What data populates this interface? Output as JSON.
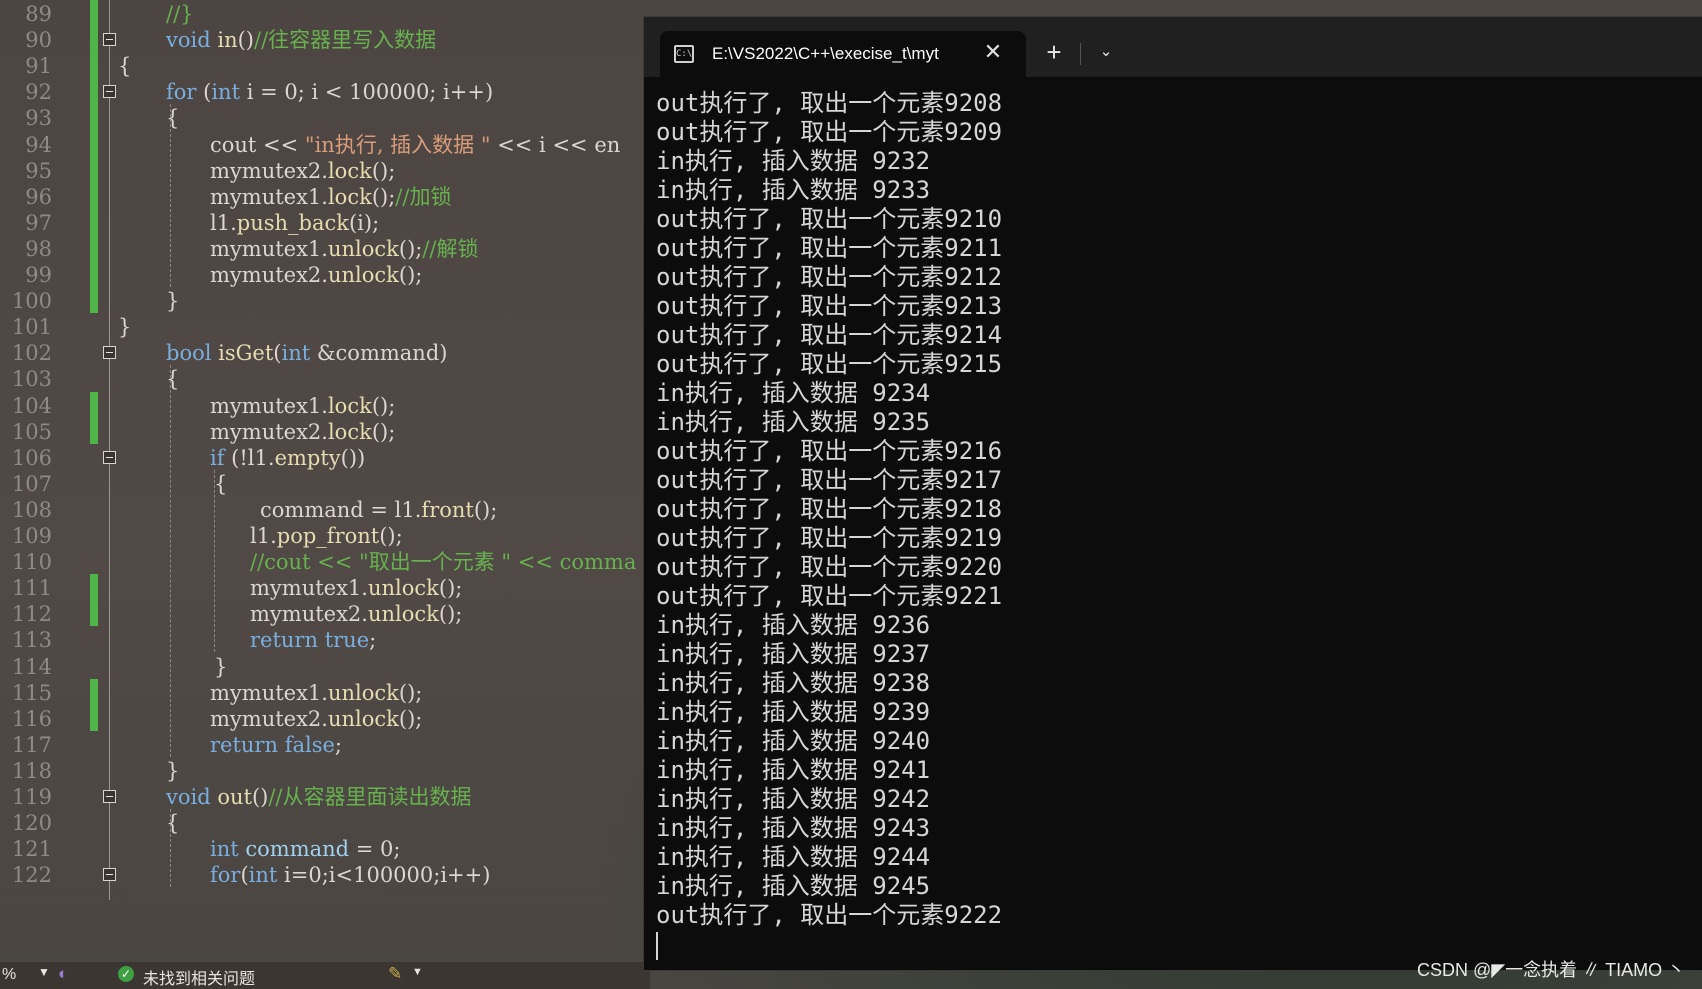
{
  "editor": {
    "line_numbers": [
      "89",
      "90",
      "91",
      "92",
      "93",
      "94",
      "95",
      "96",
      "97",
      "98",
      "99",
      "100",
      "101",
      "102",
      "103",
      "104",
      "105",
      "106",
      "107",
      "108",
      "109",
      "110",
      "111",
      "112",
      "113",
      "114",
      "115",
      "116",
      "117",
      "118",
      "119",
      "120",
      "121",
      "122"
    ],
    "lines": [
      {
        "t": [
          [
            "cm",
            "//}"
          ]
        ]
      },
      {
        "t": [
          [
            "kw",
            "void"
          ],
          [
            "p",
            " "
          ],
          [
            "fn",
            "in"
          ],
          [
            "p",
            "()"
          ],
          [
            "cm",
            "//往容器里写入数据"
          ]
        ]
      },
      {
        "t": [
          [
            "p",
            "{"
          ]
        ]
      },
      {
        "t": [
          [
            "kw",
            "for"
          ],
          [
            "p",
            " ("
          ],
          [
            "kw",
            "int"
          ],
          [
            "p",
            " i = 0; i < 100000; i++)"
          ]
        ]
      },
      {
        "t": [
          [
            "p",
            "{"
          ]
        ]
      },
      {
        "t": [
          [
            "p",
            "cout << "
          ],
          [
            "st",
            "\"in执行, 插入数据 \""
          ],
          [
            "p",
            " << i << en"
          ]
        ]
      },
      {
        "t": [
          [
            "p",
            "mymutex2."
          ],
          [
            "fn",
            "lock"
          ],
          [
            "p",
            "();"
          ]
        ]
      },
      {
        "t": [
          [
            "p",
            "mymutex1."
          ],
          [
            "fn",
            "lock"
          ],
          [
            "p",
            "();"
          ],
          [
            "cm",
            "//加锁"
          ]
        ]
      },
      {
        "t": [
          [
            "p",
            "l1."
          ],
          [
            "fn",
            "push_back"
          ],
          [
            "p",
            "(i);"
          ]
        ]
      },
      {
        "t": [
          [
            "p",
            "mymutex1."
          ],
          [
            "fn",
            "unlock"
          ],
          [
            "p",
            "();"
          ],
          [
            "cm",
            "//解锁"
          ]
        ]
      },
      {
        "t": [
          [
            "p",
            "mymutex2."
          ],
          [
            "fn",
            "unlock"
          ],
          [
            "p",
            "();"
          ]
        ]
      },
      {
        "t": [
          [
            "p",
            "}"
          ]
        ]
      },
      {
        "t": [
          [
            "p",
            "}"
          ]
        ]
      },
      {
        "t": [
          [
            "kw",
            "bool"
          ],
          [
            "p",
            " "
          ],
          [
            "fn",
            "isGet"
          ],
          [
            "p",
            "("
          ],
          [
            "kw",
            "int"
          ],
          [
            "p",
            " &command)"
          ]
        ]
      },
      {
        "t": [
          [
            "p",
            "{"
          ]
        ]
      },
      {
        "t": [
          [
            "p",
            "mymutex1."
          ],
          [
            "fn",
            "lock"
          ],
          [
            "p",
            "();"
          ]
        ]
      },
      {
        "t": [
          [
            "p",
            "mymutex2."
          ],
          [
            "fn",
            "lock"
          ],
          [
            "p",
            "();"
          ]
        ]
      },
      {
        "t": [
          [
            "kw",
            "if"
          ],
          [
            "p",
            " (!l1."
          ],
          [
            "fn",
            "empty"
          ],
          [
            "p",
            "())"
          ]
        ]
      },
      {
        "t": [
          [
            "p",
            "{"
          ]
        ]
      },
      {
        "t": [
          [
            "p",
            "command = l1."
          ],
          [
            "fn",
            "front"
          ],
          [
            "p",
            "();"
          ]
        ]
      },
      {
        "t": [
          [
            "p",
            "l1."
          ],
          [
            "fn",
            "pop_front"
          ],
          [
            "p",
            "();"
          ]
        ]
      },
      {
        "t": [
          [
            "cm",
            "//cout << \"取出一个元素 \" << comma"
          ]
        ]
      },
      {
        "t": [
          [
            "p",
            "mymutex1."
          ],
          [
            "fn",
            "unlock"
          ],
          [
            "p",
            "();"
          ]
        ]
      },
      {
        "t": [
          [
            "p",
            "mymutex2."
          ],
          [
            "fn",
            "unlock"
          ],
          [
            "p",
            "();"
          ]
        ]
      },
      {
        "t": [
          [
            "kw",
            "return"
          ],
          [
            "p",
            " "
          ],
          [
            "kw",
            "true"
          ],
          [
            "p",
            ";"
          ]
        ]
      },
      {
        "t": [
          [
            "p",
            "}"
          ]
        ]
      },
      {
        "t": [
          [
            "p",
            "mymutex1."
          ],
          [
            "fn",
            "unlock"
          ],
          [
            "p",
            "();"
          ]
        ]
      },
      {
        "t": [
          [
            "p",
            "mymutex2."
          ],
          [
            "fn",
            "unlock"
          ],
          [
            "p",
            "();"
          ]
        ]
      },
      {
        "t": [
          [
            "kw",
            "return"
          ],
          [
            "p",
            " "
          ],
          [
            "kw",
            "false"
          ],
          [
            "p",
            ";"
          ]
        ]
      },
      {
        "t": [
          [
            "p",
            "}"
          ]
        ]
      },
      {
        "t": [
          [
            "kw",
            "void"
          ],
          [
            "p",
            " "
          ],
          [
            "fn",
            "out"
          ],
          [
            "p",
            "()"
          ],
          [
            "cm",
            "//从容器里面读出数据"
          ]
        ]
      },
      {
        "t": [
          [
            "p",
            "{"
          ]
        ]
      },
      {
        "t": [
          [
            "kw",
            "int"
          ],
          [
            "p",
            " "
          ],
          [
            "vr",
            "command"
          ],
          [
            "p",
            " = 0;"
          ]
        ]
      },
      {
        "t": [
          [
            "kw",
            "for"
          ],
          [
            "p",
            "("
          ],
          [
            "kw",
            "int"
          ],
          [
            "p",
            " i=0;i<100000;i++)"
          ]
        ]
      }
    ],
    "colors": {
      "keyword": "#78aee0",
      "comment": "#67b14e",
      "string": "#d99c7a",
      "function": "#e6dcb0",
      "change_bar": "#4fb54a"
    }
  },
  "statusbar": {
    "zoom": "%",
    "issues_text": "未找到相关问题"
  },
  "terminal": {
    "tab_title": "E:\\VS2022\\C++\\execise_t\\myt",
    "tab_icon": "C:\\",
    "close_glyph": "✕",
    "new_tab_glyph": "+",
    "dropdown_glyph": "⌄",
    "output": [
      "out执行了, 取出一个元素9208",
      "out执行了, 取出一个元素9209",
      "in执行, 插入数据 9232",
      "in执行, 插入数据 9233",
      "out执行了, 取出一个元素9210",
      "out执行了, 取出一个元素9211",
      "out执行了, 取出一个元素9212",
      "out执行了, 取出一个元素9213",
      "out执行了, 取出一个元素9214",
      "out执行了, 取出一个元素9215",
      "in执行, 插入数据 9234",
      "in执行, 插入数据 9235",
      "out执行了, 取出一个元素9216",
      "out执行了, 取出一个元素9217",
      "out执行了, 取出一个元素9218",
      "out执行了, 取出一个元素9219",
      "out执行了, 取出一个元素9220",
      "out执行了, 取出一个元素9221",
      "in执行, 插入数据 9236",
      "in执行, 插入数据 9237",
      "in执行, 插入数据 9238",
      "in执行, 插入数据 9239",
      "in执行, 插入数据 9240",
      "in执行, 插入数据 9241",
      "in执行, 插入数据 9242",
      "in执行, 插入数据 9243",
      "in执行, 插入数据 9244",
      "in执行, 插入数据 9245",
      "out执行了, 取出一个元素9222"
    ]
  },
  "watermark": "CSDN @◤一念执着 ∥ TIAMO 丶"
}
